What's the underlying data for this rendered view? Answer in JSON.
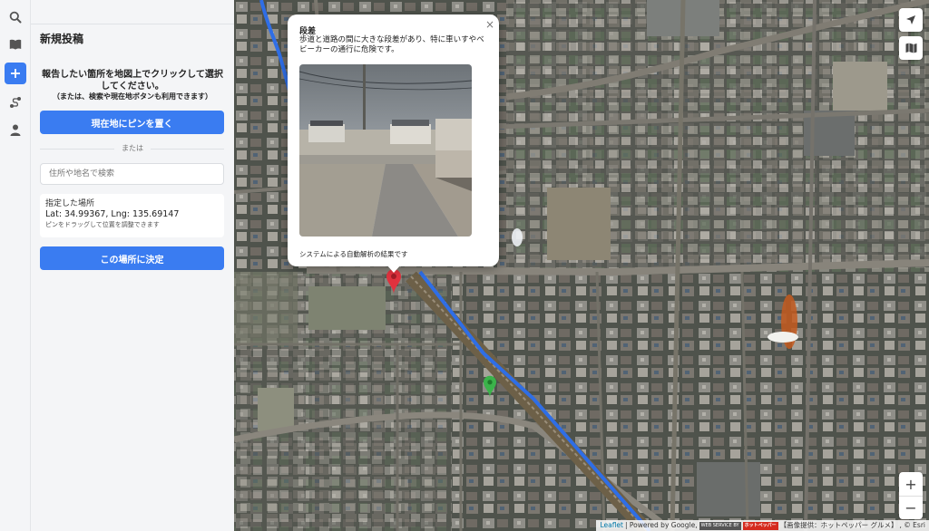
{
  "rail": {
    "items": [
      {
        "icon": "search-icon"
      },
      {
        "icon": "book-icon"
      },
      {
        "icon": "plus-icon",
        "active": true
      },
      {
        "icon": "route-icon"
      },
      {
        "icon": "user-icon"
      }
    ]
  },
  "panel": {
    "title": "新規投稿",
    "instruction": "報告したい箇所を地図上でクリックして選択してください。",
    "instruction_sub": "（または、検索や現在地ボタンも利用できます）",
    "pin_button": "現在地にピンを置く",
    "or_text": "または",
    "search_placeholder": "住所や地名で検索",
    "location_label": "指定した場所",
    "location_coords": "Lat: 34.99367, Lng: 135.69147",
    "location_hint": "ピンをドラッグして位置を調整できます",
    "confirm_button": "この場所に決定"
  },
  "popup": {
    "title": "段差",
    "description": "歩道と道路の間に大きな段差があり、特に車いすやベビーカーの通行に危険です。",
    "note": "システムによる自動解析の結果です",
    "close": "×"
  },
  "map": {
    "zoom_in": "+",
    "zoom_out": "−",
    "attribution": {
      "leaflet": "Leaflet",
      "powered": "| Powered by Google,",
      "badge1": "WEB SERVICE BY",
      "badge2": "ホットペッパー",
      "image_credit": "【画像提供：ホットペッパー グルメ】",
      "esri": ", © Esri"
    }
  },
  "colors": {
    "accent": "#3a7cf1",
    "marker_red": "#e0323e",
    "marker_green": "#3bb34a"
  }
}
